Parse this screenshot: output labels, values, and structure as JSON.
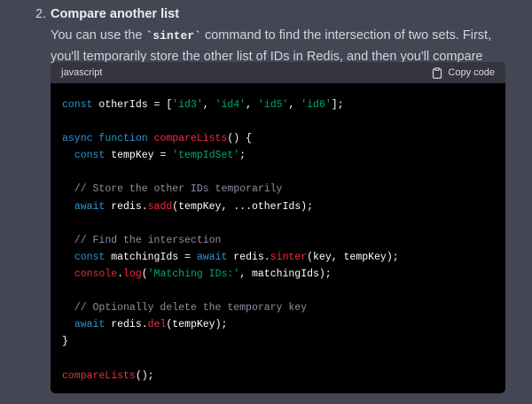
{
  "list_item": {
    "number": "2.",
    "title": "Compare another list",
    "text_before_code": "You can use the ",
    "inline_code": "`sinter`",
    "text_after_code": " command to find the intersection of two sets. First, you'll temporarily store the other list of IDs in Redis, and then you'll compare them."
  },
  "code_block": {
    "language": "javascript",
    "copy_label": "Copy code",
    "lines": [
      [
        {
          "t": "const",
          "c": "kw"
        },
        {
          "t": " otherIds = [",
          "c": "pl"
        },
        {
          "t": "'id3'",
          "c": "str"
        },
        {
          "t": ", ",
          "c": "pl"
        },
        {
          "t": "'id4'",
          "c": "str"
        },
        {
          "t": ", ",
          "c": "pl"
        },
        {
          "t": "'id5'",
          "c": "str"
        },
        {
          "t": ", ",
          "c": "pl"
        },
        {
          "t": "'id6'",
          "c": "str"
        },
        {
          "t": "];",
          "c": "pl"
        }
      ],
      [],
      [
        {
          "t": "async",
          "c": "kw"
        },
        {
          "t": " ",
          "c": "pl"
        },
        {
          "t": "function",
          "c": "kw"
        },
        {
          "t": " ",
          "c": "pl"
        },
        {
          "t": "compareLists",
          "c": "fn"
        },
        {
          "t": "() {",
          "c": "pl"
        }
      ],
      [
        {
          "t": "  ",
          "c": "pl"
        },
        {
          "t": "const",
          "c": "kw"
        },
        {
          "t": " tempKey = ",
          "c": "pl"
        },
        {
          "t": "'tempIdSet'",
          "c": "str"
        },
        {
          "t": ";",
          "c": "pl"
        }
      ],
      [],
      [
        {
          "t": "  ",
          "c": "pl"
        },
        {
          "t": "// Store the other IDs temporarily",
          "c": "cm"
        }
      ],
      [
        {
          "t": "  ",
          "c": "pl"
        },
        {
          "t": "await",
          "c": "kw"
        },
        {
          "t": " redis.",
          "c": "pl"
        },
        {
          "t": "sadd",
          "c": "fn"
        },
        {
          "t": "(tempKey, ...otherIds);",
          "c": "pl"
        }
      ],
      [],
      [
        {
          "t": "  ",
          "c": "pl"
        },
        {
          "t": "// Find the intersection",
          "c": "cm"
        }
      ],
      [
        {
          "t": "  ",
          "c": "pl"
        },
        {
          "t": "const",
          "c": "kw"
        },
        {
          "t": " matchingIds = ",
          "c": "pl"
        },
        {
          "t": "await",
          "c": "kw"
        },
        {
          "t": " redis.",
          "c": "pl"
        },
        {
          "t": "sinter",
          "c": "fn"
        },
        {
          "t": "(key, tempKey);",
          "c": "pl"
        }
      ],
      [
        {
          "t": "  ",
          "c": "pl"
        },
        {
          "t": "console",
          "c": "fn"
        },
        {
          "t": ".",
          "c": "pl"
        },
        {
          "t": "log",
          "c": "fn"
        },
        {
          "t": "(",
          "c": "pl"
        },
        {
          "t": "'Matching IDs:'",
          "c": "str"
        },
        {
          "t": ", matchingIds);",
          "c": "pl"
        }
      ],
      [],
      [
        {
          "t": "  ",
          "c": "pl"
        },
        {
          "t": "// Optionally delete the temporary key",
          "c": "cm"
        }
      ],
      [
        {
          "t": "  ",
          "c": "pl"
        },
        {
          "t": "await",
          "c": "kw"
        },
        {
          "t": " redis.",
          "c": "pl"
        },
        {
          "t": "del",
          "c": "fn"
        },
        {
          "t": "(tempKey);",
          "c": "pl"
        }
      ],
      [
        {
          "t": "}",
          "c": "pl"
        }
      ],
      [],
      [
        {
          "t": "compareLists",
          "c": "fn"
        },
        {
          "t": "();",
          "c": "pl"
        }
      ]
    ]
  },
  "icons": {
    "copy": "clipboard-icon"
  },
  "colors": {
    "page_background": "#444654",
    "code_background": "#000000",
    "code_header_background": "#343541",
    "keyword": "#2e95d3",
    "function": "#f22c3d",
    "string": "#00a67d",
    "comment": "#8e8ea0"
  }
}
